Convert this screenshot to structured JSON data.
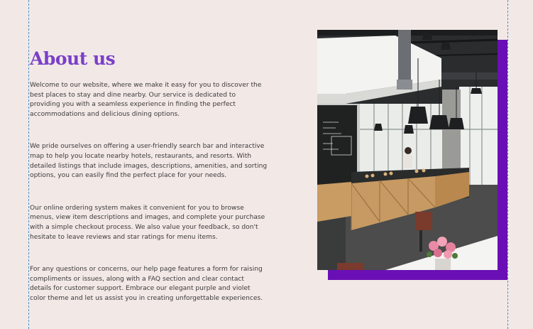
{
  "about": {
    "title": "About us",
    "paragraphs": [
      "Welcome to our website, where we make it easy for you to discover the best places to stay and dine nearby. Our service is dedicated to providing you with a seamless experience in finding the perfect accommodations and delicious dining options.",
      "We pride ourselves on offering a user-friendly search bar and interactive map to help you locate nearby hotels, restaurants, and resorts. With detailed listings that include images, descriptions, amenities, and sorting options, you can easily find the perfect place for your needs.",
      "Our online ordering system makes it convenient for you to browse menus, view item descriptions and images, and complete your purchase with a simple checkout process. We also value your feedback, so don't hesitate to leave reviews and star ratings for menu items.",
      "For any questions or concerns, our help page features a form for raising compliments or issues, along with a FAQ section and clear contact details for customer support. Embrace our elegant purple and violet color theme and let us assist you in creating unforgettable experiences."
    ]
  },
  "colors": {
    "background": "#f2e9e7",
    "title": "#7a3fc9",
    "accent_block": "#6a0fb5",
    "guides": "#4a90c8"
  }
}
